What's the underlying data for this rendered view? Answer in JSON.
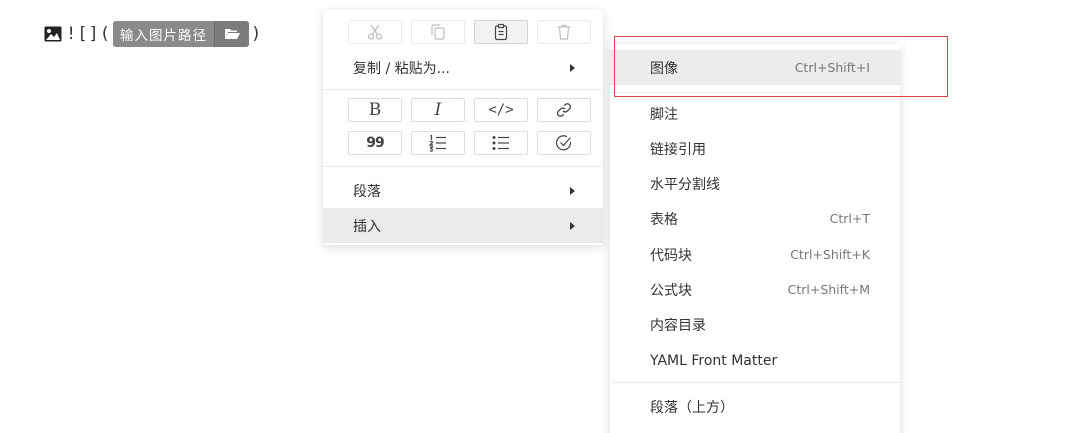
{
  "editor": {
    "prefix": "![](",
    "suffix": ")",
    "path_placeholder": "输入图片路径"
  },
  "context_menu": {
    "copy_paste_as": "复制 / 粘贴为...",
    "paragraph": "段落",
    "insert": "插入",
    "format_buttons": {
      "bold": "B",
      "italic": "I",
      "code": "</>",
      "quote": "99"
    }
  },
  "submenu": {
    "items": [
      {
        "label": "图像",
        "shortcut": "Ctrl+Shift+I"
      },
      {
        "label": "脚注",
        "shortcut": ""
      },
      {
        "label": "链接引用",
        "shortcut": ""
      },
      {
        "label": "水平分割线",
        "shortcut": ""
      },
      {
        "label": "表格",
        "shortcut": "Ctrl+T"
      },
      {
        "label": "代码块",
        "shortcut": "Ctrl+Shift+K"
      },
      {
        "label": "公式块",
        "shortcut": "Ctrl+Shift+M"
      },
      {
        "label": "内容目录",
        "shortcut": ""
      },
      {
        "label": "YAML Front Matter",
        "shortcut": ""
      },
      {
        "label": "段落（上方）",
        "shortcut": ""
      }
    ]
  },
  "colors": {
    "highlight_bg": "#ebebeb",
    "annotation_red": "#e04545",
    "path_input_bg": "#8a8a8a"
  },
  "icons": [
    "image-icon",
    "folder-open-icon",
    "cut-icon",
    "copy-icon",
    "paste-icon",
    "delete-icon",
    "link-icon",
    "ordered-list-icon",
    "unordered-list-icon",
    "task-list-icon"
  ]
}
